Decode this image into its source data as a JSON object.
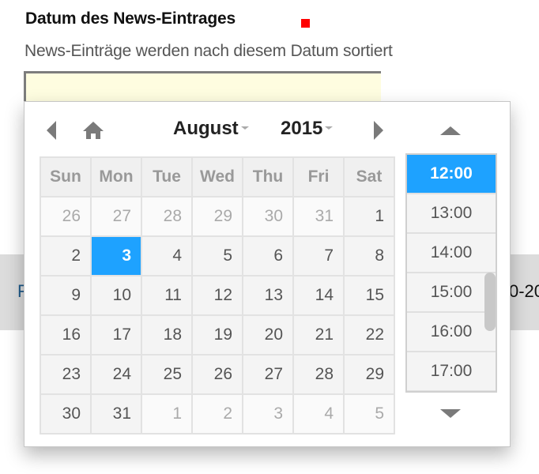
{
  "field": {
    "title": "Datum des News-Eintrages",
    "description": "News-Einträge werden nach diesem Datum sortiert",
    "input_value": "",
    "required_color": "#ff0000"
  },
  "background": {
    "left_text": "F",
    "right_text": "0-20"
  },
  "picker": {
    "month": "August",
    "year": "2015",
    "accent_color": "#1ea2ff",
    "weekdays": [
      "Sun",
      "Mon",
      "Tue",
      "Wed",
      "Thu",
      "Fri",
      "Sat"
    ],
    "weeks": [
      [
        {
          "d": "26",
          "other": true
        },
        {
          "d": "27",
          "other": true
        },
        {
          "d": "28",
          "other": true
        },
        {
          "d": "29",
          "other": true
        },
        {
          "d": "30",
          "other": true
        },
        {
          "d": "31",
          "other": true
        },
        {
          "d": "1",
          "other": false
        }
      ],
      [
        {
          "d": "2",
          "other": false
        },
        {
          "d": "3",
          "other": false,
          "selected": true
        },
        {
          "d": "4",
          "other": false
        },
        {
          "d": "5",
          "other": false
        },
        {
          "d": "6",
          "other": false
        },
        {
          "d": "7",
          "other": false
        },
        {
          "d": "8",
          "other": false
        }
      ],
      [
        {
          "d": "9",
          "other": false
        },
        {
          "d": "10",
          "other": false
        },
        {
          "d": "11",
          "other": false
        },
        {
          "d": "12",
          "other": false
        },
        {
          "d": "13",
          "other": false
        },
        {
          "d": "14",
          "other": false
        },
        {
          "d": "15",
          "other": false
        }
      ],
      [
        {
          "d": "16",
          "other": false
        },
        {
          "d": "17",
          "other": false
        },
        {
          "d": "18",
          "other": false
        },
        {
          "d": "19",
          "other": false
        },
        {
          "d": "20",
          "other": false
        },
        {
          "d": "21",
          "other": false
        },
        {
          "d": "22",
          "other": false
        }
      ],
      [
        {
          "d": "23",
          "other": false
        },
        {
          "d": "24",
          "other": false
        },
        {
          "d": "25",
          "other": false
        },
        {
          "d": "26",
          "other": false
        },
        {
          "d": "27",
          "other": false
        },
        {
          "d": "28",
          "other": false
        },
        {
          "d": "29",
          "other": false
        }
      ],
      [
        {
          "d": "30",
          "other": false
        },
        {
          "d": "31",
          "other": false
        },
        {
          "d": "1",
          "other": true
        },
        {
          "d": "2",
          "other": true
        },
        {
          "d": "3",
          "other": true
        },
        {
          "d": "4",
          "other": true
        },
        {
          "d": "5",
          "other": true
        }
      ]
    ],
    "times": [
      "12:00",
      "13:00",
      "14:00",
      "15:00",
      "16:00",
      "17:00"
    ],
    "selected_time": "12:00",
    "icons": {
      "prev": "chevron-left-icon",
      "home": "home-icon",
      "next": "chevron-right-icon",
      "time_up": "triangle-up-icon",
      "time_down": "triangle-down-icon"
    }
  }
}
